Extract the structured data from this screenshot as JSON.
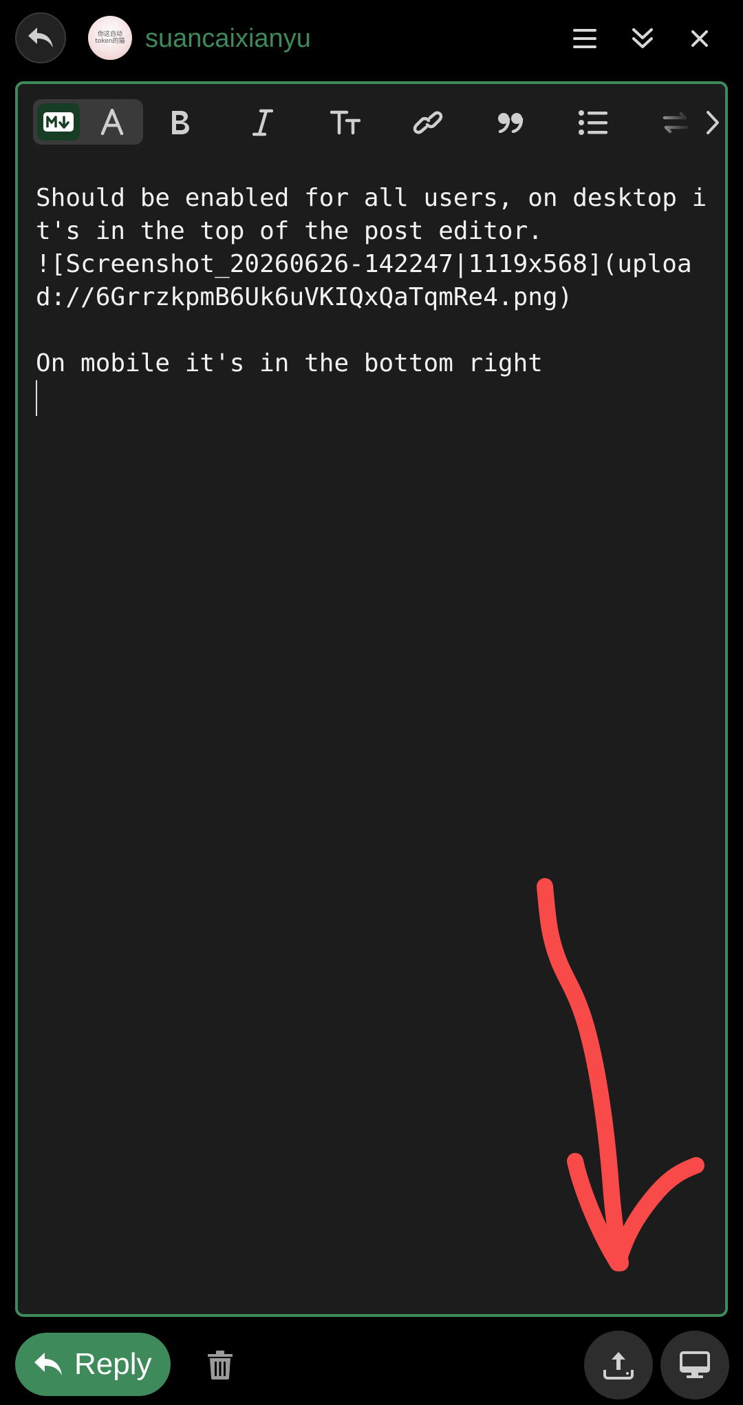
{
  "header": {
    "back_icon": "reply-back-icon",
    "avatar_text_line1": "你这自动",
    "avatar_text_line2": "token的猫",
    "username": "suancaixianyu",
    "menu_icon": "hamburger-menu-icon",
    "collapse_icon": "double-chevron-down-icon",
    "close_icon": "close-icon"
  },
  "toolbar": {
    "items": [
      {
        "name": "markdown-mode",
        "icon": "markdown-icon"
      },
      {
        "name": "rich-text-mode",
        "icon": "letter-a-icon"
      },
      {
        "name": "bold",
        "icon": "bold-icon"
      },
      {
        "name": "italic",
        "icon": "italic-icon"
      },
      {
        "name": "heading",
        "icon": "text-size-icon"
      },
      {
        "name": "link",
        "icon": "link-icon"
      },
      {
        "name": "quote",
        "icon": "quote-icon"
      },
      {
        "name": "bullet-list",
        "icon": "bullet-list-icon"
      },
      {
        "name": "more",
        "icon": "chevron-right-icon"
      }
    ]
  },
  "editor": {
    "text": "Should be enabled for all users, on desktop it's in the top of the post editor.\n![Screenshot_20260626-142247|1119x568](upload://6GrrzkpmB6Uk6uVKIQxQaTqmRe4.png)\n\nOn mobile it's in the bottom right\n",
    "annotation": "red-arrow-pointing-bottom-right",
    "annotation_color": "#f94a4a"
  },
  "footer": {
    "reply_label": "Reply",
    "reply_icon": "reply-icon",
    "trash_icon": "trash-icon",
    "upload_icon": "upload-icon",
    "desktop_icon": "desktop-icon"
  },
  "colors": {
    "accent": "#3f8a5a",
    "background": "#000000",
    "editor_bg": "#1c1c1c"
  }
}
